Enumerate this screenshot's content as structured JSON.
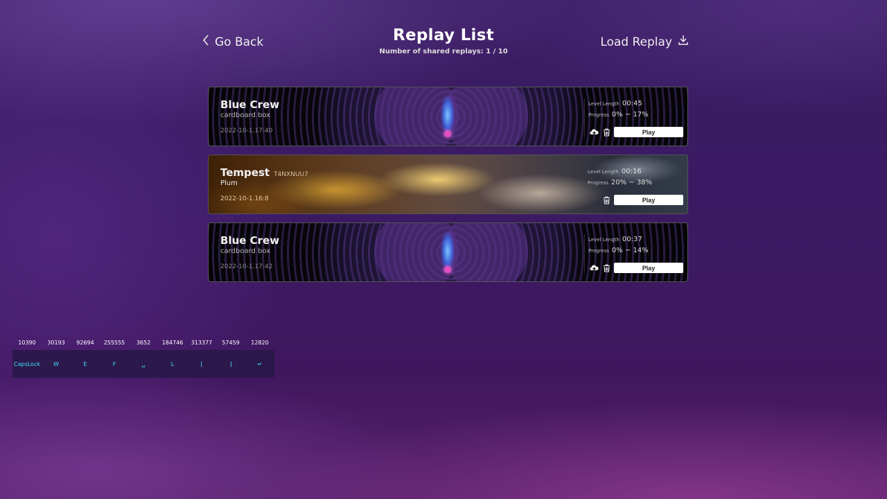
{
  "header": {
    "go_back": "Go Back",
    "title": "Replay List",
    "subtitle": "Number of shared replays: 1 / 10",
    "load_replay": "Load Replay"
  },
  "labels": {
    "level_length": "Level Length",
    "progress": "Progress",
    "play": "Play"
  },
  "replays": [
    {
      "name": "Blue Crew",
      "code": "",
      "subtitle": "cardboard box",
      "date": "2022-10-1.17:40",
      "length": "00:45",
      "progress": "0% ~ 17%",
      "shared": false
    },
    {
      "name": "Tempest",
      "code": "T4NXNUU7",
      "subtitle": "Plum",
      "date": "2022-10-1.16:8",
      "length": "00:16",
      "progress": "20% ~ 38%",
      "shared": true
    },
    {
      "name": "Blue Crew",
      "code": "",
      "subtitle": "cardboard box",
      "date": "2022-10-1.17:42",
      "length": "00:37",
      "progress": "0% ~ 14%",
      "shared": false
    }
  ],
  "key_overlay": {
    "counts": [
      "10390",
      "30193",
      "92694",
      "255555",
      "3652",
      "184746",
      "313377",
      "57459",
      "12820"
    ],
    "keys": [
      "CapsLock",
      "W",
      "E",
      "F",
      "␣",
      "L",
      "[",
      "]",
      "↵"
    ]
  },
  "colors": {
    "accent_key": "#3fe0ff",
    "play_bg": "#ffffff"
  }
}
